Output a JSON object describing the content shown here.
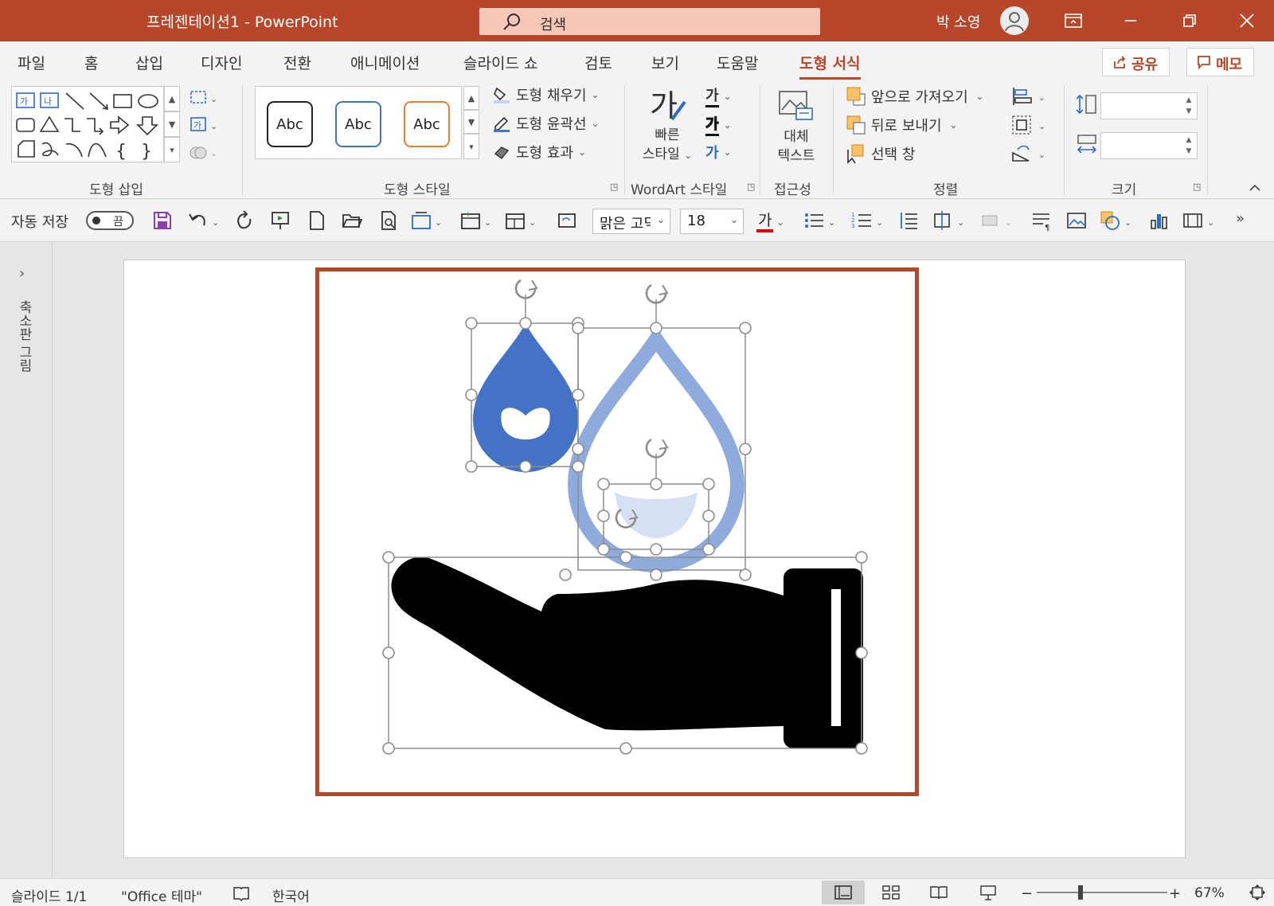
{
  "titlebar": {
    "title": "프레젠테이션1  -  PowerPoint",
    "search_placeholder": "검색",
    "user_name": "박 소영"
  },
  "tabs": [
    {
      "label": "파일"
    },
    {
      "label": "홈"
    },
    {
      "label": "삽입"
    },
    {
      "label": "디자인"
    },
    {
      "label": "전환"
    },
    {
      "label": "애니메이션"
    },
    {
      "label": "슬라이드 쇼"
    },
    {
      "label": "검토"
    },
    {
      "label": "보기"
    },
    {
      "label": "도움말"
    },
    {
      "label": "도형 서식"
    }
  ],
  "tab_buttons": {
    "share": "공유",
    "comments": "메모"
  },
  "ribbon": {
    "groups": {
      "insert_shapes": "도형 삽입",
      "shape_styles": "도형 스타일",
      "wordart_styles": "WordArt 스타일",
      "accessibility": "접근성",
      "arrange": "정렬",
      "size": "크기"
    },
    "style_gallery": [
      "Abc",
      "Abc",
      "Abc"
    ],
    "shape_fill": "도형 채우기",
    "shape_outline": "도형 윤곽선",
    "shape_effects": "도형 효과",
    "quick_styles_line1": "빠른",
    "quick_styles_line2": "스타일",
    "wordart_glyph": "가",
    "alt_text_line1": "대체",
    "alt_text_line2": "텍스트",
    "bring_forward": "앞으로 가져오기",
    "send_backward": "뒤로 보내기",
    "selection_pane": "선택 창",
    "height_value": "",
    "width_value": ""
  },
  "qat": {
    "autosave_label": "자동 저장",
    "autosave_state": "끔",
    "font_name": "맑은 고딕",
    "font_size": "18",
    "font_color_glyph": "가"
  },
  "thumbpane": {
    "label": "축소판 그림"
  },
  "statusbar": {
    "slide_info": "슬라이드 1/1",
    "theme": "\"Office 테마\"",
    "language": "한국어",
    "zoom_minus": "−",
    "zoom_plus": "+",
    "zoom": "67%"
  },
  "colors": {
    "accent": "#b7472a",
    "drop_small": "#4472c4",
    "drop_large": "#8faadc",
    "hand": "#000000"
  },
  "slide_art": {
    "objects": [
      "water-drop-small",
      "water-drop-outline-large",
      "smile-inner",
      "hand-icon"
    ]
  }
}
